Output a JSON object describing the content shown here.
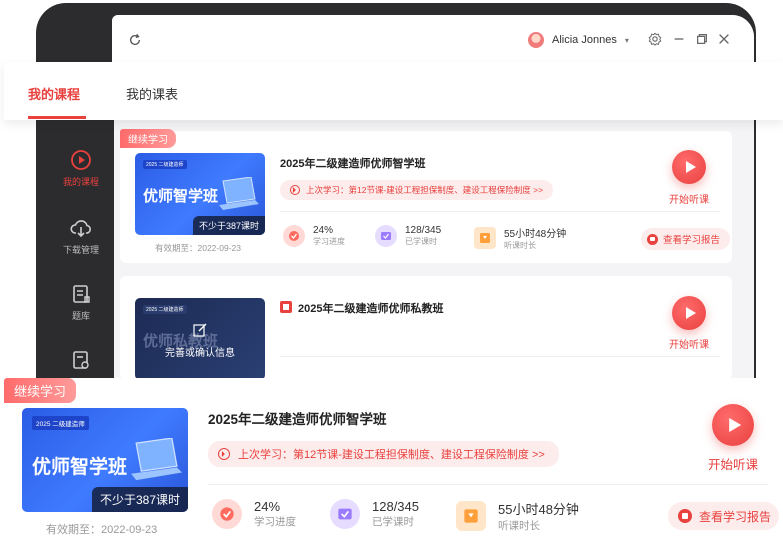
{
  "header": {
    "user_name": "Alicia Jonnes",
    "icons": [
      "refresh-icon",
      "settings-icon",
      "minimize-icon",
      "restore-icon",
      "close-icon"
    ]
  },
  "tabs": [
    {
      "label": "我的课程",
      "active": true
    },
    {
      "label": "我的课表",
      "active": false
    }
  ],
  "sidebar": {
    "items": [
      {
        "label": "我的课程",
        "icon": "play-circle-icon",
        "active": true
      },
      {
        "label": "下载管理",
        "icon": "cloud-download-icon",
        "active": false
      },
      {
        "label": "题库",
        "icon": "question-bank-icon",
        "active": false
      }
    ]
  },
  "colors": {
    "accent": "#e8413e",
    "accent_light": "#fdecec",
    "cover_blue": "#3f7bff",
    "sidebar_bg": "#2c2c2e"
  },
  "courses": [
    {
      "badge": "继续学习",
      "cover_small": "2025 二级建造师",
      "cover_title": "优师智学班",
      "cover_hours": "不少于387课时",
      "valid_until": "有效期至：2022-09-23",
      "title": "2025年二级建造师优师智学班",
      "last_learn": "上次学习：第12节课-建设工程担保制度、建设工程保险制度 >>",
      "play_label": "开始听课",
      "stats": [
        {
          "value": "24%",
          "label": "学习进度",
          "icon": "progress-icon"
        },
        {
          "value": "128/345",
          "label": "已学课时",
          "icon": "lessons-icon"
        },
        {
          "value": "55小时48分钟",
          "label": "听课时长",
          "icon": "duration-icon"
        }
      ],
      "report_label": "查看学习报告"
    },
    {
      "cover_small": "2025 二级建造师",
      "cover_title": "优师私教班",
      "cover_overlay": "完善或确认信息",
      "title": "2025年二级建造师优师私教班",
      "play_label": "开始听课"
    }
  ]
}
